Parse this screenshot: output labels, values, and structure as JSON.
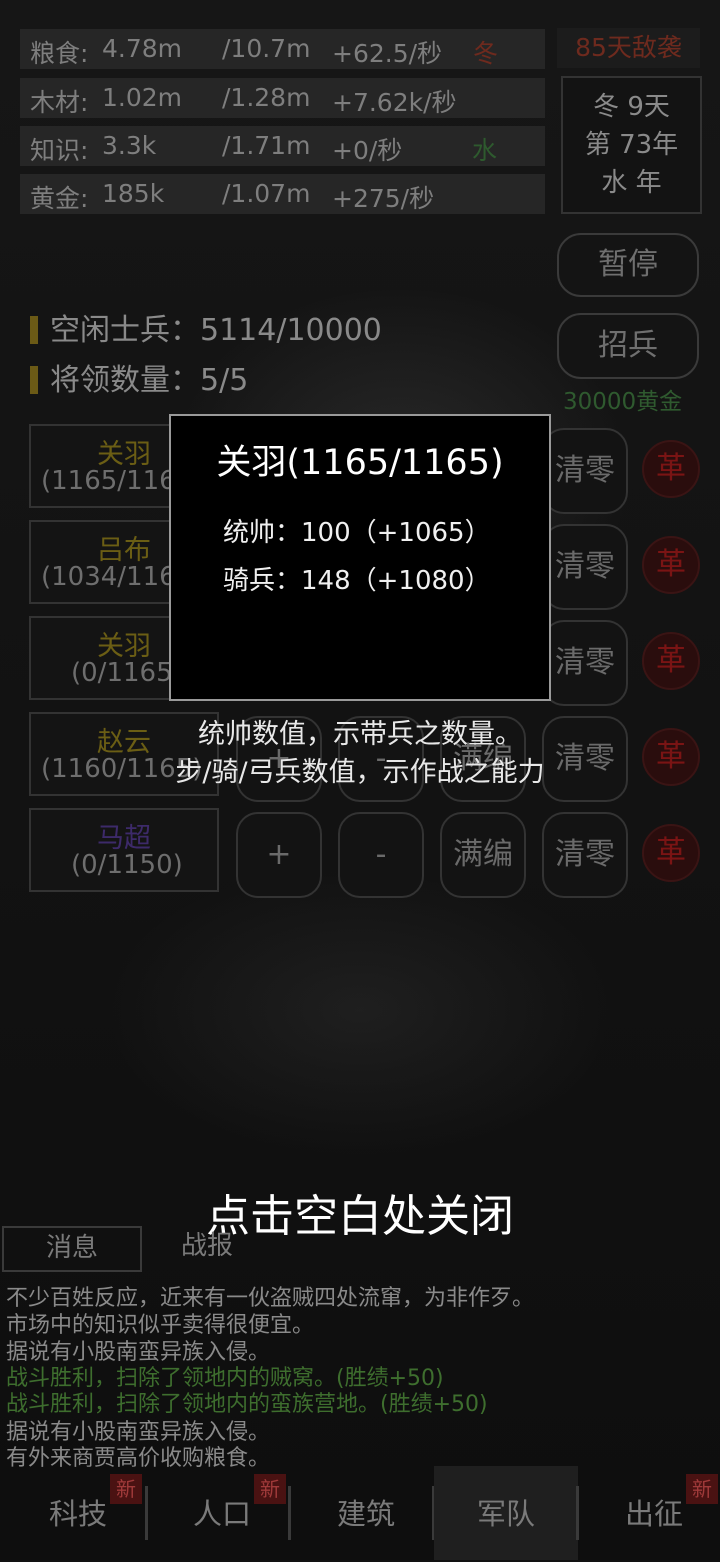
{
  "resources": [
    {
      "name": "粮食:",
      "amount": "4.78m",
      "cap": "/10.7m",
      "rate": "+62.5/秒",
      "tag": "冬",
      "tag_type": "season"
    },
    {
      "name": "木材:",
      "amount": "1.02m",
      "cap": "/1.28m",
      "rate": "+7.62k/秒",
      "tag": "",
      "tag_type": ""
    },
    {
      "name": "知识:",
      "amount": "3.3k",
      "cap": "/1.71m",
      "rate": "+0/秒",
      "tag": "水",
      "tag_type": "element"
    },
    {
      "name": "黄金:",
      "amount": "185k",
      "cap": "/1.07m",
      "rate": "+275/秒",
      "tag": "",
      "tag_type": ""
    }
  ],
  "enemy_warning": "85天敌袭",
  "calendar": {
    "line1": "冬 9天",
    "line2": "第 73年",
    "line3": "水 年"
  },
  "pause_label": "暂停",
  "recruit_label": "招兵",
  "recruit_cost": "30000黄金",
  "idle_soldiers": "空闲士兵：5114/10000",
  "general_count": "将领数量：5/5",
  "generals": [
    {
      "name": "关羽",
      "troops": "(1165/1165)",
      "name_color": "#6b5e14"
    },
    {
      "name": "吕布",
      "troops": "(1034/1165)",
      "name_color": "#6b5e14"
    },
    {
      "name": "关羽",
      "troops": "(0/1165)",
      "name_color": "#6b5e14"
    },
    {
      "name": "赵云",
      "troops": "(1160/1165)",
      "name_color": "#6b5e14"
    },
    {
      "name": "马超",
      "troops": "(0/1150)",
      "name_color": "#3d2a6a"
    }
  ],
  "actions": {
    "add": "+",
    "sub": "-",
    "full": "满编",
    "clear": "清零",
    "reform": "革"
  },
  "modal": {
    "title": "关羽(1165/1165)",
    "command": "统帅：100（+1065）",
    "cavalry": "骑兵：148（+1080）"
  },
  "help_line1": "统帅数值，示带兵之数量。",
  "help_line2": "步/骑/弓兵数值，示作战之能力",
  "close_hint": "点击空白处关闭",
  "message_tabs": [
    "消息",
    "战报"
  ],
  "messages": [
    {
      "text": "不少百姓反应，近来有一伙盗贼四处流窜，为非作歹。",
      "color": "#8a8a8a"
    },
    {
      "text": "市场中的知识似乎卖得很便宜。",
      "color": "#8a8a8a"
    },
    {
      "text": "据说有小股南蛮异族入侵。",
      "color": "#8a8a8a"
    },
    {
      "text": "战斗胜利，扫除了领地内的贼窝。(胜绩+50)",
      "color": "#3e6e2e"
    },
    {
      "text": "战斗胜利，扫除了领地内的蛮族营地。(胜绩+50)",
      "color": "#3e6e2e"
    },
    {
      "text": "据说有小股南蛮异族入侵。",
      "color": "#8a8a8a"
    },
    {
      "text": "有外来商贾高价收购粮食。",
      "color": "#8a8a8a"
    }
  ],
  "nav": [
    {
      "label": "科技",
      "badge": "新"
    },
    {
      "label": "人口",
      "badge": "新"
    },
    {
      "label": "建筑",
      "badge": ""
    },
    {
      "label": "军队",
      "badge": ""
    },
    {
      "label": "出征",
      "badge": "新"
    }
  ]
}
